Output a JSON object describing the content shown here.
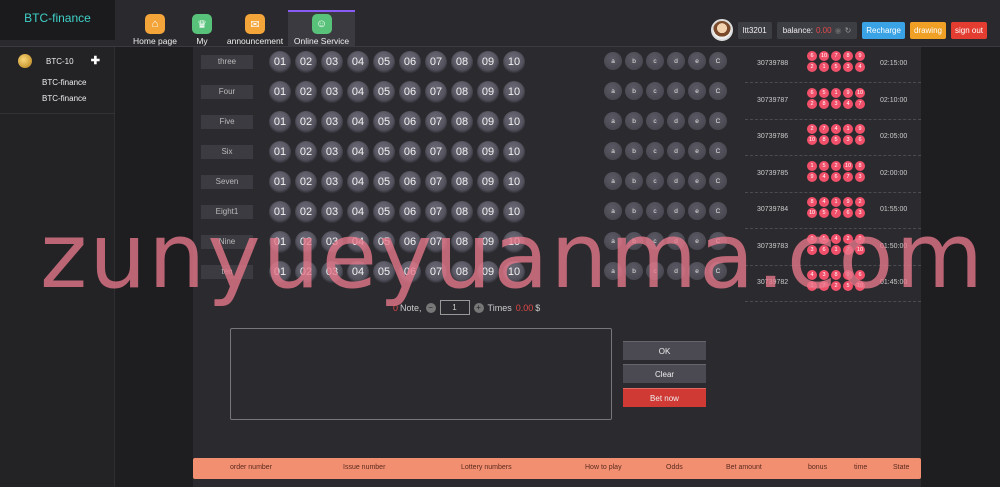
{
  "brand": {
    "title": "BTC-finance"
  },
  "nav": [
    {
      "label": "Home page",
      "icon": "home-icon",
      "color": "#f3a53a",
      "glyph": "⌂"
    },
    {
      "label": "My",
      "icon": "crown-icon",
      "color": "#59c27a",
      "glyph": "♛"
    },
    {
      "label": "announcement",
      "icon": "mail-icon",
      "color": "#f3a53a",
      "glyph": "✉"
    },
    {
      "label": "Online Service",
      "icon": "support-icon",
      "color": "#59c27a",
      "glyph": "☺"
    }
  ],
  "user": {
    "name": "ltt3201",
    "balance_label": "balance:",
    "balance_value": "0.00",
    "recharge": "Recharge",
    "drawing": "drawing",
    "signout": "sign out"
  },
  "sidebar": {
    "game": "BTC-10",
    "links": [
      "BTC-finance",
      "BTC-finance"
    ]
  },
  "rows": [
    {
      "label": "three"
    },
    {
      "label": "Four"
    },
    {
      "label": "Five"
    },
    {
      "label": "Six"
    },
    {
      "label": "Seven"
    },
    {
      "label": "Eight1"
    },
    {
      "label": "Nine"
    },
    {
      "label": "ten"
    }
  ],
  "balls": [
    "01",
    "02",
    "03",
    "04",
    "05",
    "06",
    "07",
    "08",
    "09",
    "10"
  ],
  "options": [
    "a",
    "b",
    "c",
    "d",
    "e",
    "C"
  ],
  "history": [
    {
      "issue": "30739788",
      "nums": [
        "6",
        "10",
        "7",
        "8",
        "9",
        "2",
        "1",
        "5",
        "3",
        "4"
      ],
      "time": "02:15:00"
    },
    {
      "issue": "30739787",
      "nums": [
        "6",
        "5",
        "1",
        "9",
        "10",
        "2",
        "8",
        "3",
        "4",
        "7"
      ],
      "time": "02:10:00"
    },
    {
      "issue": "30739786",
      "nums": [
        "2",
        "7",
        "4",
        "1",
        "9",
        "10",
        "8",
        "5",
        "3",
        "6"
      ],
      "time": "02:05:00"
    },
    {
      "issue": "30739785",
      "nums": [
        "1",
        "5",
        "2",
        "10",
        "8",
        "9",
        "4",
        "6",
        "7",
        "3"
      ],
      "time": "02:00:00"
    },
    {
      "issue": "30739784",
      "nums": [
        "8",
        "4",
        "1",
        "9",
        "2",
        "10",
        "5",
        "7",
        "6",
        "3"
      ],
      "time": "01:55:00"
    },
    {
      "issue": "30739783",
      "nums": [
        "9",
        "5",
        "4",
        "2",
        "8",
        "3",
        "6",
        "1",
        "7",
        "10"
      ],
      "time": "01:50:00"
    },
    {
      "issue": "30739782",
      "nums": [
        "4",
        "3",
        "8",
        "9",
        "6",
        "1",
        "7",
        "2",
        "5",
        "10"
      ],
      "time": "01:45:00"
    }
  ],
  "bet": {
    "notes_count": "0",
    "notes_label": "Note,",
    "times_value": "1",
    "times_label": "Times",
    "amount": "0.00",
    "currency": "$",
    "ok": "OK",
    "clear": "Clear",
    "bet_now": "Bet now"
  },
  "orders_header": [
    "order number",
    "Issue number",
    "Lottery numbers",
    "How to play",
    "Odds",
    "Bet amount",
    "bonus",
    "time",
    "State"
  ],
  "watermark": "zunyueyuanma.com"
}
